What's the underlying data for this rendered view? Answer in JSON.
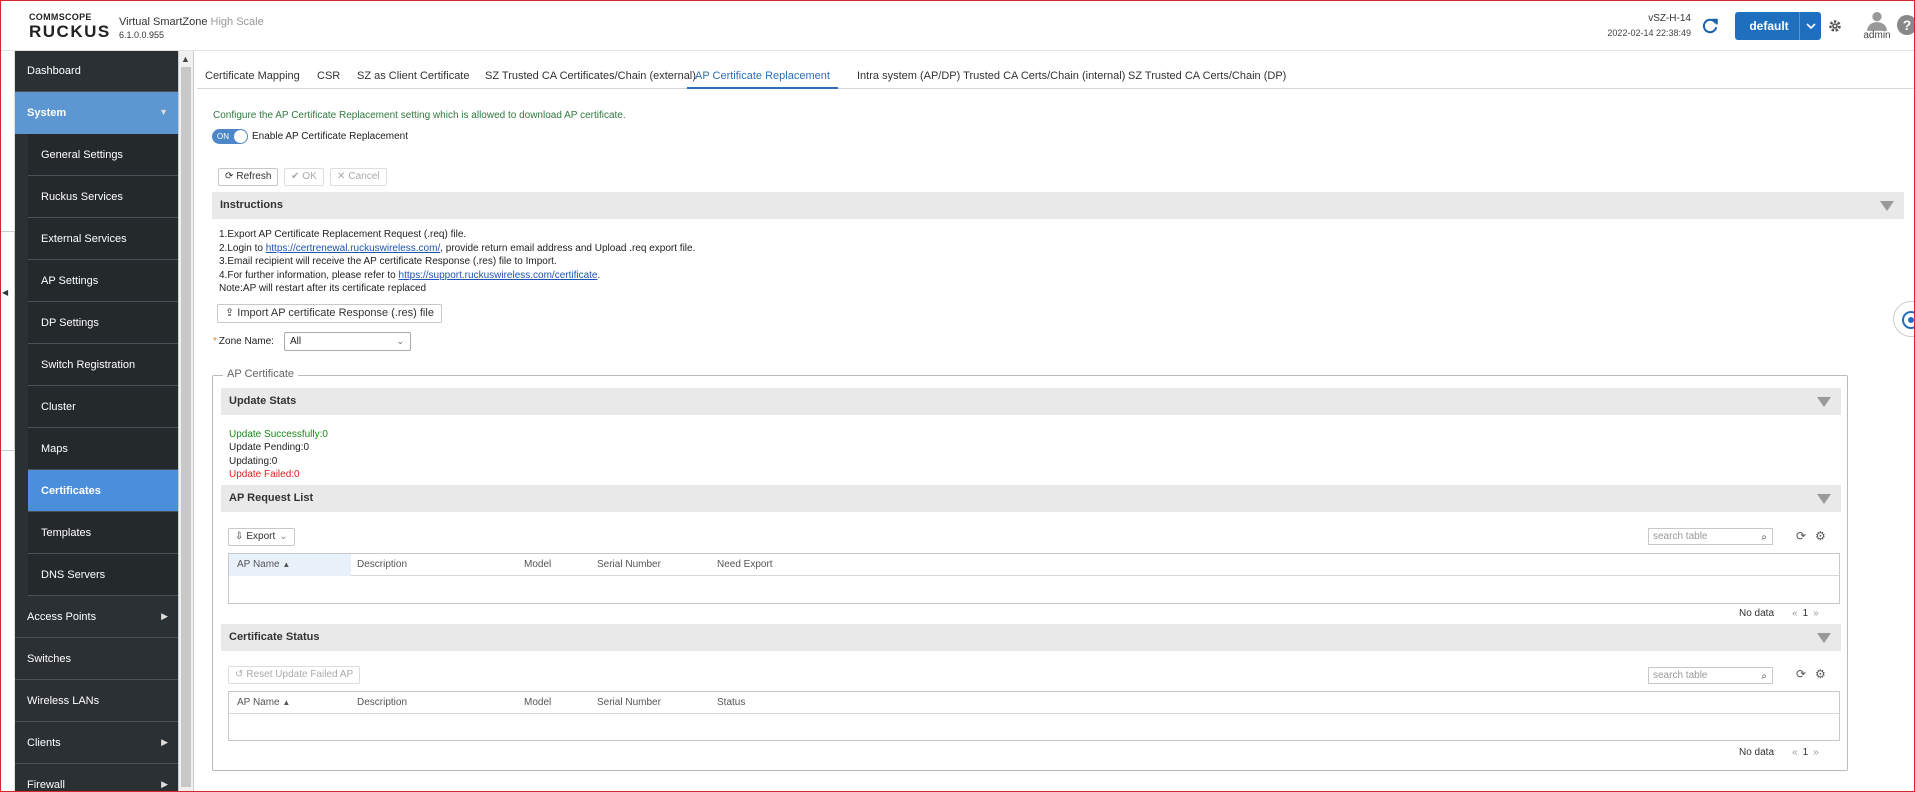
{
  "header": {
    "logo_top": "COMMSCOPE",
    "logo_main": "RUCKUS",
    "product": "Virtual SmartZone",
    "product_tag": "High Scale",
    "version": "6.1.0.0.955",
    "host": "vSZ-H-14",
    "timestamp": "2022-02-14  22:38:49",
    "domain": "default",
    "user": "admin",
    "help": "?"
  },
  "sidebar": {
    "items": [
      {
        "label": "Dashboard"
      },
      {
        "label": "System"
      },
      {
        "label": "General Settings"
      },
      {
        "label": "Ruckus Services"
      },
      {
        "label": "External Services"
      },
      {
        "label": "AP Settings"
      },
      {
        "label": "DP Settings"
      },
      {
        "label": "Switch Registration"
      },
      {
        "label": "Cluster"
      },
      {
        "label": "Maps"
      },
      {
        "label": "Certificates"
      },
      {
        "label": "Templates"
      },
      {
        "label": "DNS Servers"
      },
      {
        "label": "Access Points"
      },
      {
        "label": "Switches"
      },
      {
        "label": "Wireless LANs"
      },
      {
        "label": "Clients"
      },
      {
        "label": "Firewall"
      }
    ]
  },
  "tabs": [
    {
      "label": "Certificate Mapping"
    },
    {
      "label": "CSR"
    },
    {
      "label": "SZ as Client Certificate"
    },
    {
      "label": "SZ Trusted CA Certificates/Chain (external)"
    },
    {
      "label": "AP Certificate Replacement"
    },
    {
      "label": "Intra system (AP/DP) Trusted CA Certs/Chain (internal)"
    },
    {
      "label": "SZ Trusted CA Certs/Chain (DP)"
    }
  ],
  "content": {
    "intro": "Configure the AP Certificate Replacement setting which is allowed to download AP certificate.",
    "toggle_state": "ON",
    "toggle_label": "Enable AP Certificate Replacement",
    "refresh": "Refresh",
    "ok": "OK",
    "cancel": "Cancel",
    "instructions_title": "Instructions",
    "step1": "1.Export AP Certificate Replacement Request (.req) file.",
    "step2_pre": "2.Login to ",
    "step2_link": "https://certrenewal.ruckuswireless.com/",
    "step2_post": ", provide return email address and Upload .req export file.",
    "step3": "3.Email recipient will receive the AP certificate Response (.res) file to Import.",
    "step4_pre": "4.For further information, please refer to ",
    "step4_link": "https://support.ruckuswireless.com/certificate",
    "step4_post": ".",
    "note": "Note:AP will restart after its certificate replaced",
    "import": "Import AP certificate Response (.res) file",
    "zone_label": "Zone Name:",
    "zone_value": "All",
    "ap_cert_legend": "AP Certificate",
    "update_stats_title": "Update Stats",
    "stat_success": "Update Successfully:0",
    "stat_pending": "Update Pending:0",
    "stat_updating": "Updating:0",
    "stat_failed": "Update Failed:0",
    "request_list_title": "AP Request List",
    "export": "Export",
    "search_placeholder": "search table",
    "request_columns": [
      "AP Name",
      "Description",
      "Model",
      "Serial Number",
      "Need Export"
    ],
    "no_data": "No data",
    "page": "1",
    "cert_status_title": "Certificate Status",
    "reset": "Reset Update Failed AP",
    "status_columns": [
      "AP Name",
      "Description",
      "Model",
      "Serial Number",
      "Status"
    ]
  },
  "colors": {
    "accent": "#2d6fb5",
    "sidebar_bg": "#2b3034",
    "sidebar_active": "#4b8fdc",
    "success": "#1a8a1a",
    "failed": "#e02020"
  }
}
